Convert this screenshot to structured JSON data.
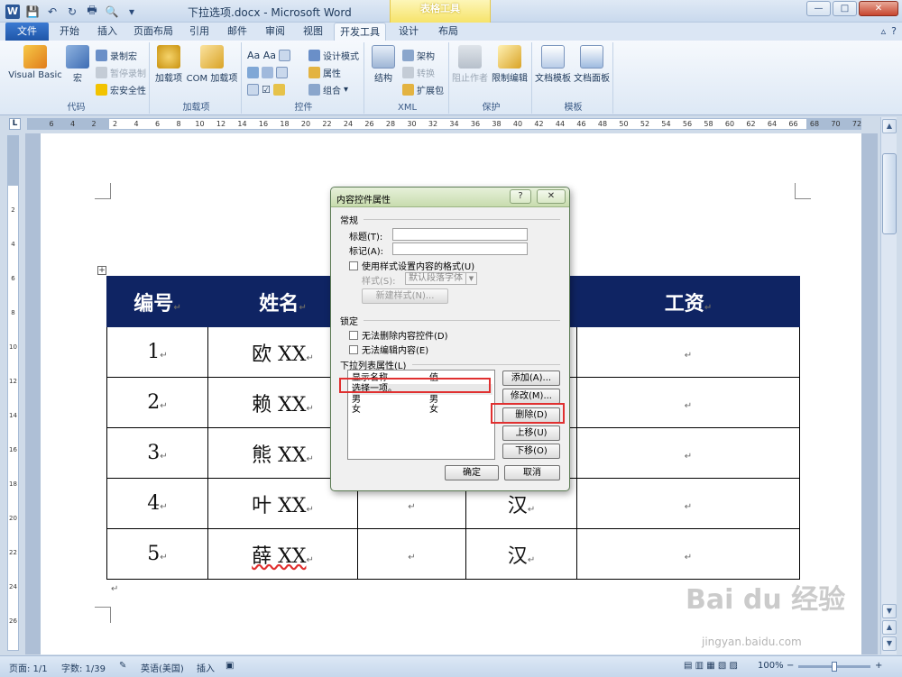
{
  "window": {
    "title": "下拉选项.docx - Microsoft Word",
    "context_tab": "表格工具",
    "btn_min": "—",
    "btn_max": "□",
    "btn_close": "✕"
  },
  "quick_access": {
    "logo": "W",
    "save": "💾",
    "undo": "↶",
    "redo": "↻",
    "print": "🖶",
    "preview": "🔍",
    "more": "▾"
  },
  "tabs": {
    "file": "文件",
    "items": [
      "开始",
      "插入",
      "页面布局",
      "引用",
      "邮件",
      "审阅",
      "视图",
      "开发工具",
      "设计",
      "布局"
    ],
    "right_help": "?",
    "right_collapse": "▵"
  },
  "ribbon": {
    "code": {
      "label": "代码",
      "visual_basic": "Visual Basic",
      "macros": "宏",
      "record_macro": "录制宏",
      "pause_recording": "暂停录制",
      "macro_security": "宏安全性"
    },
    "addins": {
      "label": "加载项",
      "addins": "加载项",
      "com_addins": "COM 加载项"
    },
    "controls": {
      "label": "控件",
      "design_mode": "设计模式",
      "properties": "属性",
      "group": "组合"
    },
    "xml": {
      "label": "XML",
      "structure": "结构",
      "schema": "架构",
      "transform": "转换",
      "expansion_pack": "扩展包"
    },
    "protect": {
      "label": "保护",
      "block_authors": "阻止作者",
      "restrict_editing": "限制编辑"
    },
    "templates": {
      "label": "模板",
      "document_template": "文档模板",
      "document_panel": "文档面板"
    }
  },
  "ruler": {
    "corner": "L",
    "ticks": [
      "6",
      "4",
      "2",
      "2",
      "4",
      "6",
      "8",
      "10",
      "12",
      "14",
      "16",
      "18",
      "20",
      "22",
      "24",
      "26",
      "28",
      "30",
      "32",
      "34",
      "36",
      "38",
      "40",
      "42",
      "44",
      "46",
      "48",
      "50",
      "52",
      "54",
      "56",
      "58",
      "60",
      "62",
      "64",
      "66",
      "68",
      "70",
      "72"
    ],
    "vticks": [
      "2",
      "4",
      "6",
      "8",
      "10",
      "12",
      "14",
      "16",
      "18",
      "20",
      "22",
      "24",
      "26"
    ]
  },
  "table": {
    "headers": [
      "编号",
      "姓名",
      "",
      "",
      "工资"
    ],
    "rows": [
      [
        "1",
        "欧 XX",
        "",
        "",
        ""
      ],
      [
        "2",
        "赖 XX",
        "",
        "",
        ""
      ],
      [
        "3",
        "熊 XX",
        "",
        "",
        ""
      ],
      [
        "4",
        "叶 XX",
        "",
        "汉",
        ""
      ],
      [
        "5",
        "薛 XX",
        "",
        "汉",
        ""
      ]
    ],
    "cell_mark": "↵",
    "handle": "+"
  },
  "dialog": {
    "title": "内容控件属性",
    "help": "?",
    "close": "✕",
    "general": {
      "label": "常规",
      "title_label": "标题(T):",
      "tag_label": "标记(A):",
      "title_value": "",
      "tag_value": "",
      "use_style": "使用样式设置内容的格式(U)",
      "style_label": "样式(S):",
      "style_value": "默认段落字体",
      "new_style": "新建样式(N)..."
    },
    "locking": {
      "label": "锁定",
      "cannot_delete": "无法删除内容控件(D)",
      "cannot_edit": "无法编辑内容(E)"
    },
    "dropdown": {
      "label": "下拉列表属性(L)",
      "col_display": "显示名称",
      "col_value": "值",
      "items": [
        {
          "display": "选择一项。",
          "value": ""
        },
        {
          "display": "男",
          "value": "男"
        },
        {
          "display": "女",
          "value": "女"
        }
      ],
      "add": "添加(A)...",
      "modify": "修改(M)...",
      "delete": "删除(D)",
      "move_up": "上移(U)",
      "move_down": "下移(O)"
    },
    "ok": "确定",
    "cancel": "取消"
  },
  "status": {
    "page": "页面: 1/1",
    "words": "字数: 1/39",
    "language": "英语(美国)",
    "mode": "插入",
    "zoom": "100%",
    "zoom_minus": "−",
    "zoom_plus": "+"
  },
  "watermark": {
    "main": "Bai du 经验",
    "sub": "jingyan.baidu.com"
  }
}
